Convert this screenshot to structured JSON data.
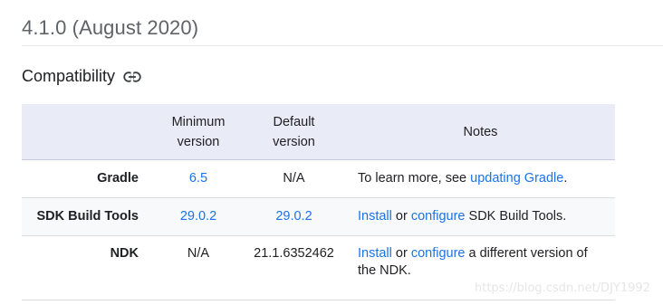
{
  "version_title": "4.1.0 (August 2020)",
  "section": {
    "heading": "Compatibility",
    "link_icon": "link-icon"
  },
  "table": {
    "headers": [
      "",
      "Minimum\nversion",
      "Default\nversion",
      "Notes"
    ],
    "rows": [
      {
        "component": "Gradle",
        "minimum": "6.5",
        "default": "N/A",
        "notes_prefix": "To learn more, see ",
        "notes_link": "updating Gradle",
        "notes_suffix": "."
      },
      {
        "component": "SDK Build Tools",
        "minimum": "29.0.2",
        "default": "29.0.2",
        "notes_link1": "Install",
        "notes_mid": " or ",
        "notes_link2": "configure",
        "notes_suffix": " SDK Build Tools."
      },
      {
        "component": "NDK",
        "minimum": "N/A",
        "default": "21.1.6352462",
        "notes_link1": "Install",
        "notes_mid": " or ",
        "notes_link2": "configure",
        "notes_suffix": " a different version of the NDK."
      }
    ]
  },
  "watermark": "https://blog.csdn.net/DJY1992",
  "colors": {
    "link": "#1a73e8",
    "header_bg": "#e9ecf6"
  }
}
